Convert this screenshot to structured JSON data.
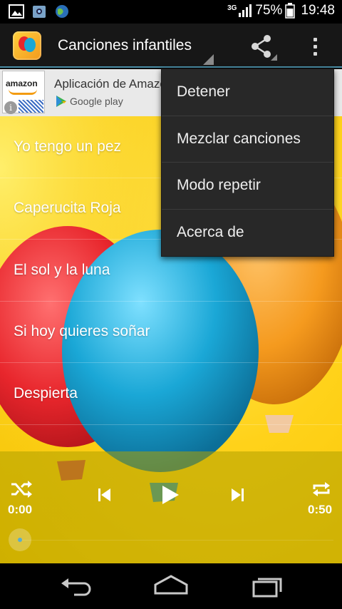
{
  "status_bar": {
    "network": "3G",
    "battery": "75%",
    "time": "19:48",
    "icons": [
      "gallery-icon",
      "photo-icon",
      "globe-icon",
      "signal-icon",
      "battery-icon"
    ]
  },
  "action_bar": {
    "title": "Canciones infantiles",
    "icons": [
      "app-balloon-icon",
      "share-icon",
      "overflow-menu-icon"
    ]
  },
  "ad": {
    "logo_text": "amazon",
    "title": "Aplicación de Amazon",
    "store_label": "Google play",
    "icons": [
      "info-icon",
      "play-store-icon"
    ]
  },
  "songs": [
    {
      "label": "Yo tengo un pez"
    },
    {
      "label": "Caperucita Roja"
    },
    {
      "label": "El sol y la luna"
    },
    {
      "label": "Si hoy quieres soñar"
    },
    {
      "label": "Despierta"
    }
  ],
  "player": {
    "current_time": "0:00",
    "total_time": "0:50",
    "progress": 0,
    "icons": [
      "shuffle-icon",
      "previous-icon",
      "play-icon",
      "next-icon",
      "repeat-icon"
    ]
  },
  "menu": {
    "items": [
      {
        "label": "Detener"
      },
      {
        "label": "Mezclar canciones"
      },
      {
        "label": "Modo repetir"
      },
      {
        "label": "Acerca de"
      }
    ]
  },
  "nav_bar": {
    "icons": [
      "back-icon",
      "home-icon",
      "recents-icon"
    ]
  },
  "colors": {
    "background_yellow": "#ffd21a",
    "balloon_red": "#e8262c",
    "balloon_blue": "#1aa7d6",
    "balloon_orange": "#f59a1e",
    "action_bar": "#171717",
    "menu_bg": "#282828",
    "accent_line": "#4b8ea6"
  }
}
